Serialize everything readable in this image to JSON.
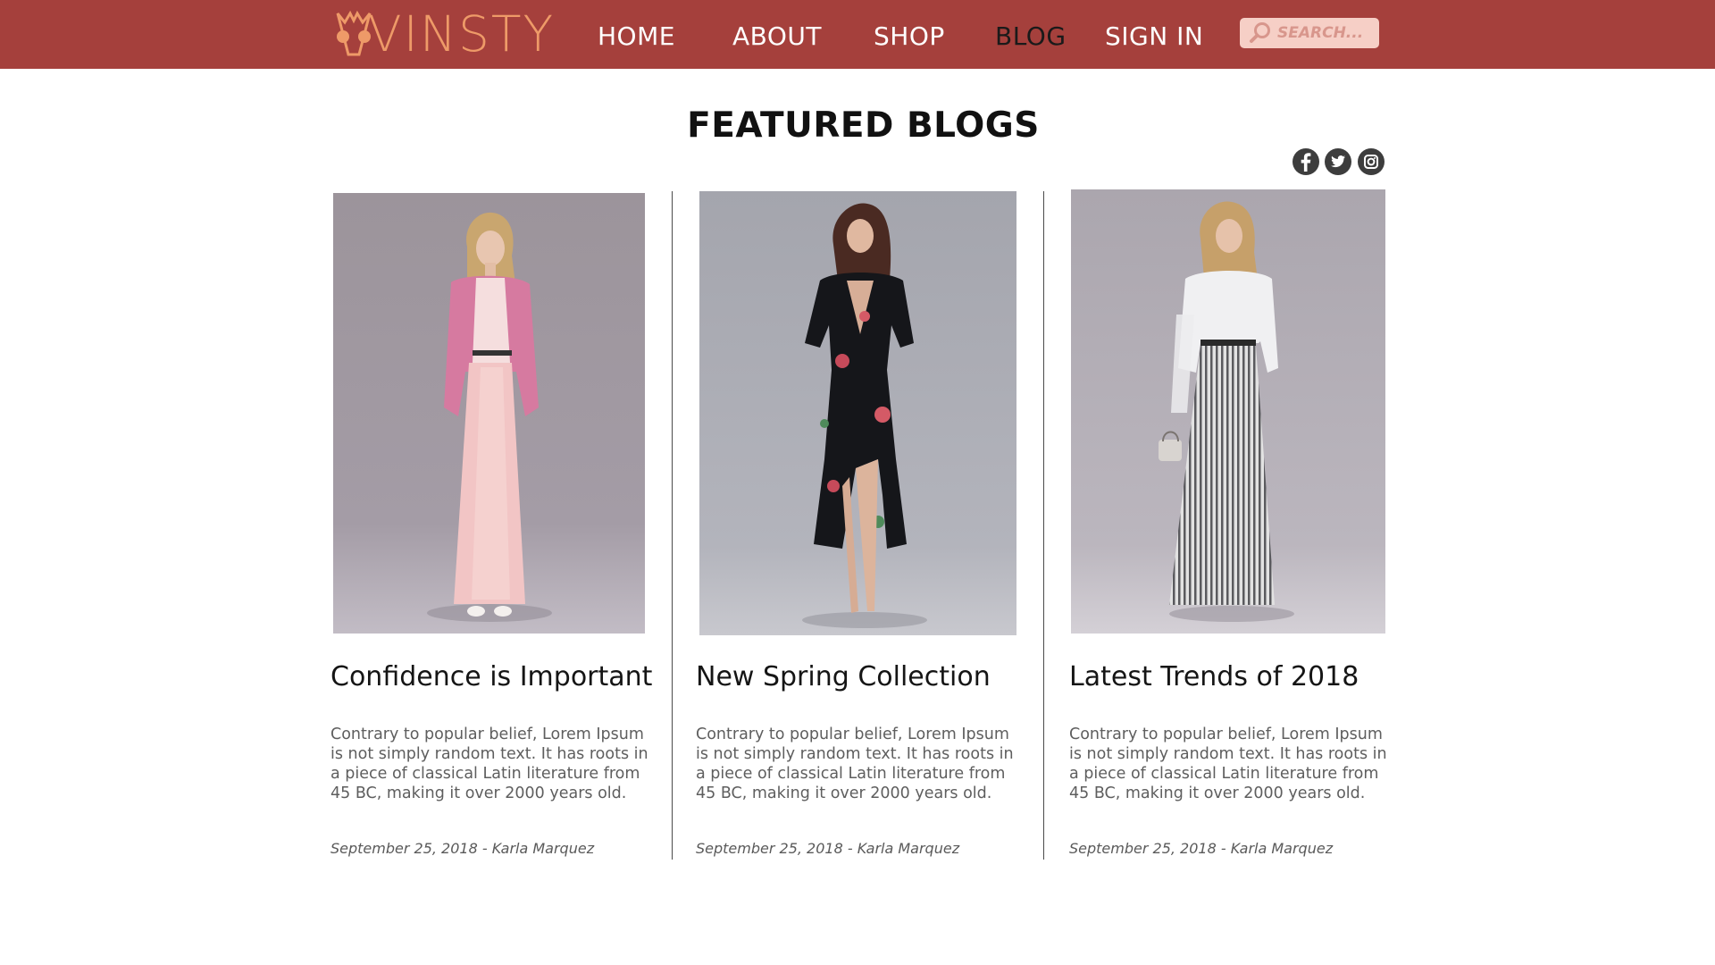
{
  "header": {
    "logo_text": "VINSTY",
    "nav": [
      {
        "label": "HOME"
      },
      {
        "label": "ABOUT"
      },
      {
        "label": "SHOP"
      },
      {
        "label": "BLOG",
        "active": true
      },
      {
        "label": "SIGN IN"
      }
    ],
    "search": {
      "placeholder": "SEARCH..."
    },
    "colors": {
      "bar": "#a5403c",
      "logo": "#ee9a68",
      "active_nav": "#1a1a1a",
      "search_bg": "#f6cfc6"
    }
  },
  "page": {
    "title": "FEATURED BLOGS"
  },
  "social": [
    {
      "icon": "facebook-icon"
    },
    {
      "icon": "twitter-icon"
    },
    {
      "icon": "instagram-icon"
    }
  ],
  "blogs": [
    {
      "image": "model-pink-jacket-photo",
      "title": "Confidence is Important",
      "excerpt": "Contrary to popular belief, Lorem Ipsum is not simply random text. It has roots in a piece of classical Latin literature from 45 BC, making it over 2000 years old.",
      "meta": "September 25, 2018 - Karla Marquez"
    },
    {
      "image": "model-floral-dress-photo",
      "title": "New Spring Collection",
      "excerpt": "Contrary to popular belief, Lorem Ipsum is not simply random text. It has roots in a piece of classical Latin literature from 45 BC, making it over 2000 years old.",
      "meta": "September 25, 2018 - Karla Marquez"
    },
    {
      "image": "model-striped-pants-photo",
      "title": "Latest Trends  of 2018",
      "excerpt": "Contrary to popular belief, Lorem Ipsum is not simply random text. It has roots in a piece of classical Latin literature from 45 BC, making it over 2000 years old.",
      "meta": "September 25, 2018 - Karla Marquez"
    }
  ]
}
